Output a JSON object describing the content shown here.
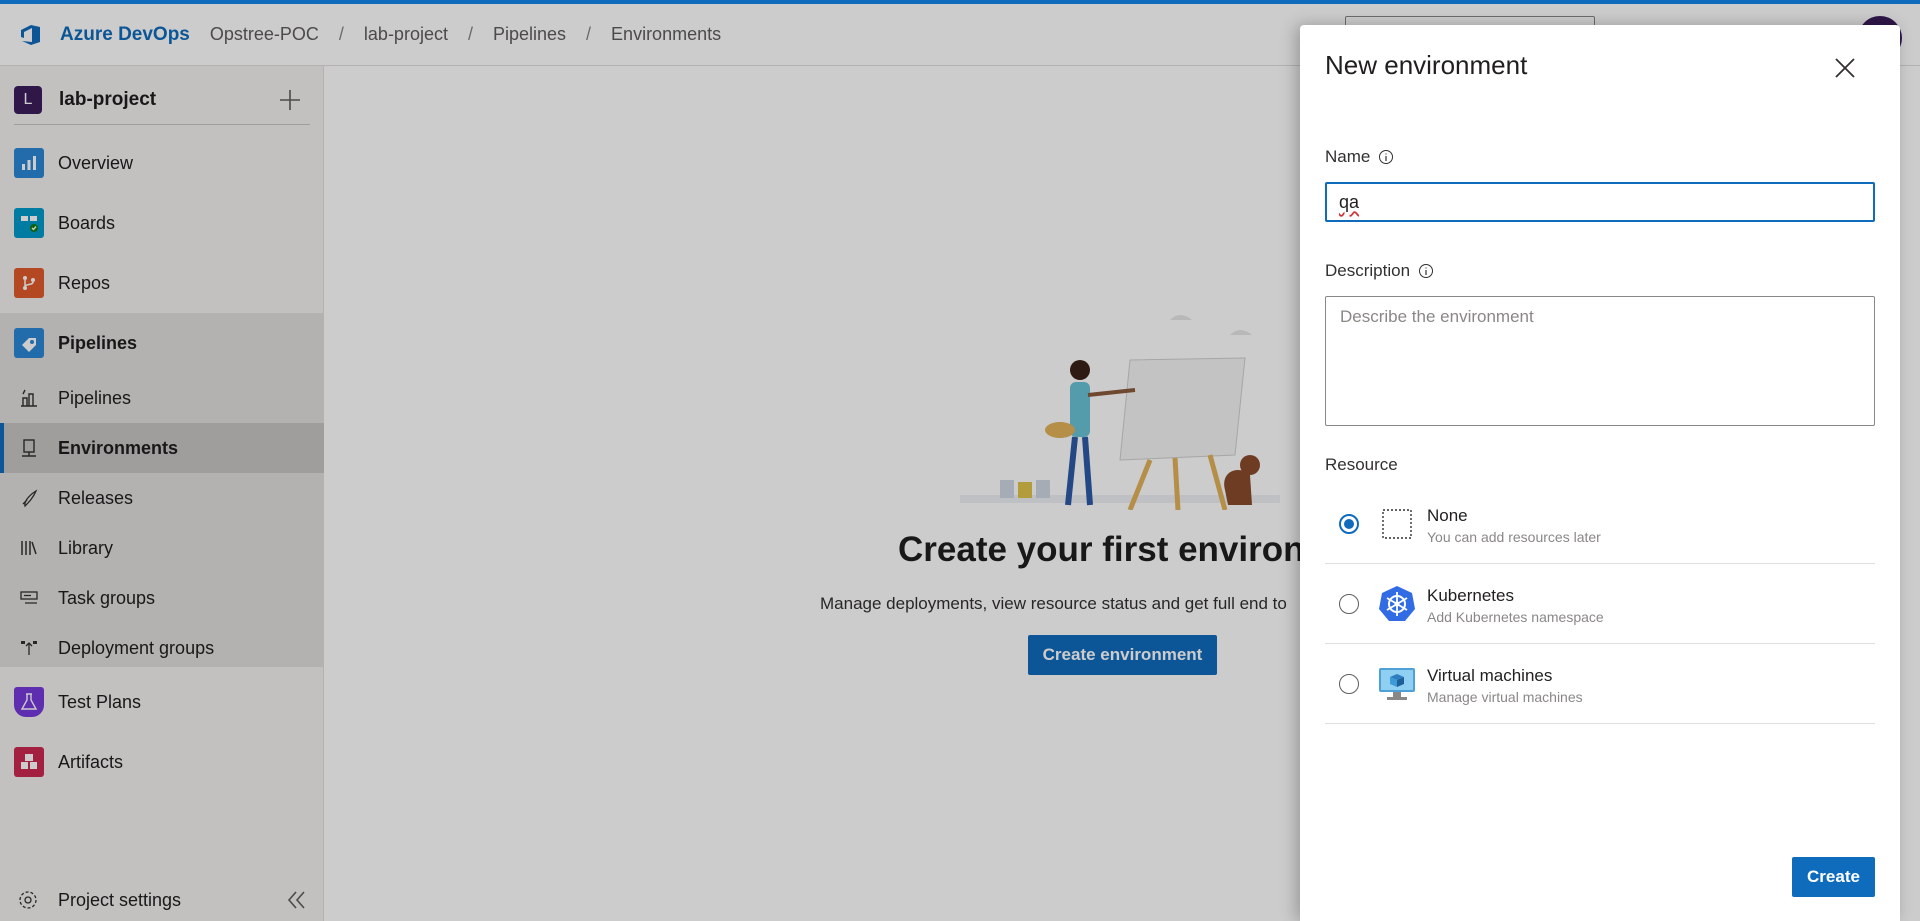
{
  "topbar": {
    "brand": "Azure DevOps",
    "breadcrumbs": [
      "Opstree-POC",
      "lab-project",
      "Pipelines",
      "Environments"
    ],
    "separator": "/"
  },
  "sidebar": {
    "project_badge": "L",
    "project_name": "lab-project",
    "items": [
      {
        "label": "Overview",
        "icon": "overview-icon",
        "color": "#2b88d8"
      },
      {
        "label": "Boards",
        "icon": "boards-icon",
        "color": "#009ccc"
      },
      {
        "label": "Repos",
        "icon": "repos-icon",
        "color": "#e05b2b"
      },
      {
        "label": "Pipelines",
        "icon": "pipelines-icon",
        "color": "#2b88d8"
      },
      {
        "label": "Pipelines",
        "icon": "pipelines-sub-icon"
      },
      {
        "label": "Environments",
        "icon": "environments-icon"
      },
      {
        "label": "Releases",
        "icon": "releases-icon"
      },
      {
        "label": "Library",
        "icon": "library-icon"
      },
      {
        "label": "Task groups",
        "icon": "task-groups-icon"
      },
      {
        "label": "Deployment groups",
        "icon": "deployment-groups-icon"
      },
      {
        "label": "Test Plans",
        "icon": "test-plans-icon",
        "color": "#773adc"
      },
      {
        "label": "Artifacts",
        "icon": "artifacts-icon",
        "color": "#cc2952"
      }
    ],
    "settings_label": "Project settings"
  },
  "main": {
    "empty_title": "Create your first environme",
    "empty_desc": "Manage deployments, view resource status and get full end to",
    "create_button": "Create environment"
  },
  "panel": {
    "title": "New environment",
    "name_label": "Name",
    "name_value": "qa",
    "description_label": "Description",
    "description_placeholder": "Describe the environment",
    "resource_label": "Resource",
    "options": [
      {
        "title": "None",
        "subtitle": "You can add resources later",
        "selected": true
      },
      {
        "title": "Kubernetes",
        "subtitle": "Add Kubernetes namespace",
        "selected": false
      },
      {
        "title": "Virtual machines",
        "subtitle": "Manage virtual machines",
        "selected": false
      }
    ],
    "create_button": "Create"
  },
  "colors": {
    "accent": "#0f6cbd",
    "overlay": "rgba(0,0,0,0.2)"
  }
}
